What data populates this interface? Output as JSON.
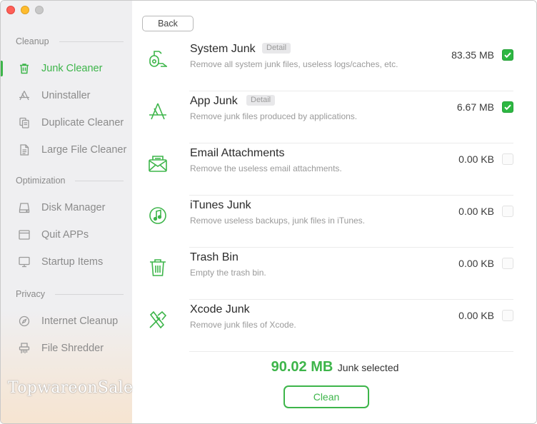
{
  "window": {
    "controls": [
      "close",
      "minimize",
      "maximize"
    ]
  },
  "sidebar": {
    "sections": [
      {
        "title": "Cleanup",
        "items": [
          {
            "label": "Junk Cleaner",
            "icon": "trash-icon",
            "active": true
          },
          {
            "label": "Uninstaller",
            "icon": "app-store-icon",
            "active": false
          },
          {
            "label": "Duplicate Cleaner",
            "icon": "duplicate-icon",
            "active": false
          },
          {
            "label": "Large File Cleaner",
            "icon": "document-icon",
            "active": false
          }
        ]
      },
      {
        "title": "Optimization",
        "items": [
          {
            "label": "Disk Manager",
            "icon": "disk-icon",
            "active": false
          },
          {
            "label": "Quit APPs",
            "icon": "window-icon",
            "active": false
          },
          {
            "label": "Startup Items",
            "icon": "monitor-icon",
            "active": false
          }
        ]
      },
      {
        "title": "Privacy",
        "items": [
          {
            "label": "Internet Cleanup",
            "icon": "compass-icon",
            "active": false
          },
          {
            "label": "File Shredder",
            "icon": "shredder-icon",
            "active": false
          }
        ]
      }
    ]
  },
  "watermark": "TopwareonSale",
  "toolbar": {
    "back_label": "Back"
  },
  "detail_label": "Detail",
  "junk_items": [
    {
      "title": "System Junk",
      "has_detail": true,
      "description": "Remove all system junk files, useless logs/caches, etc.",
      "size": "83.35 MB",
      "checked": true,
      "icon": "vacuum-icon"
    },
    {
      "title": "App Junk",
      "has_detail": true,
      "description": "Remove junk files produced by applications.",
      "size": "6.67 MB",
      "checked": true,
      "icon": "app-store-icon"
    },
    {
      "title": "Email Attachments",
      "has_detail": false,
      "description": "Remove the useless email attachments.",
      "size": "0.00 KB",
      "checked": false,
      "icon": "mail-icon"
    },
    {
      "title": "iTunes Junk",
      "has_detail": false,
      "description": "Remove useless backups, junk files in iTunes.",
      "size": "0.00 KB",
      "checked": false,
      "icon": "music-icon"
    },
    {
      "title": "Trash Bin",
      "has_detail": false,
      "description": "Empty the trash bin.",
      "size": "0.00 KB",
      "checked": false,
      "icon": "trash-icon"
    },
    {
      "title": "Xcode Junk",
      "has_detail": false,
      "description": "Remove junk files of Xcode.",
      "size": "0.00 KB",
      "checked": false,
      "icon": "hammer-icon"
    }
  ],
  "summary": {
    "amount": "90.02 MB",
    "label": "Junk selected"
  },
  "clean_button": {
    "label": "Clean"
  },
  "colors": {
    "accent": "#3db54a",
    "checkbox_on": "#2db742",
    "sidebar_bg": "#efeff1"
  }
}
